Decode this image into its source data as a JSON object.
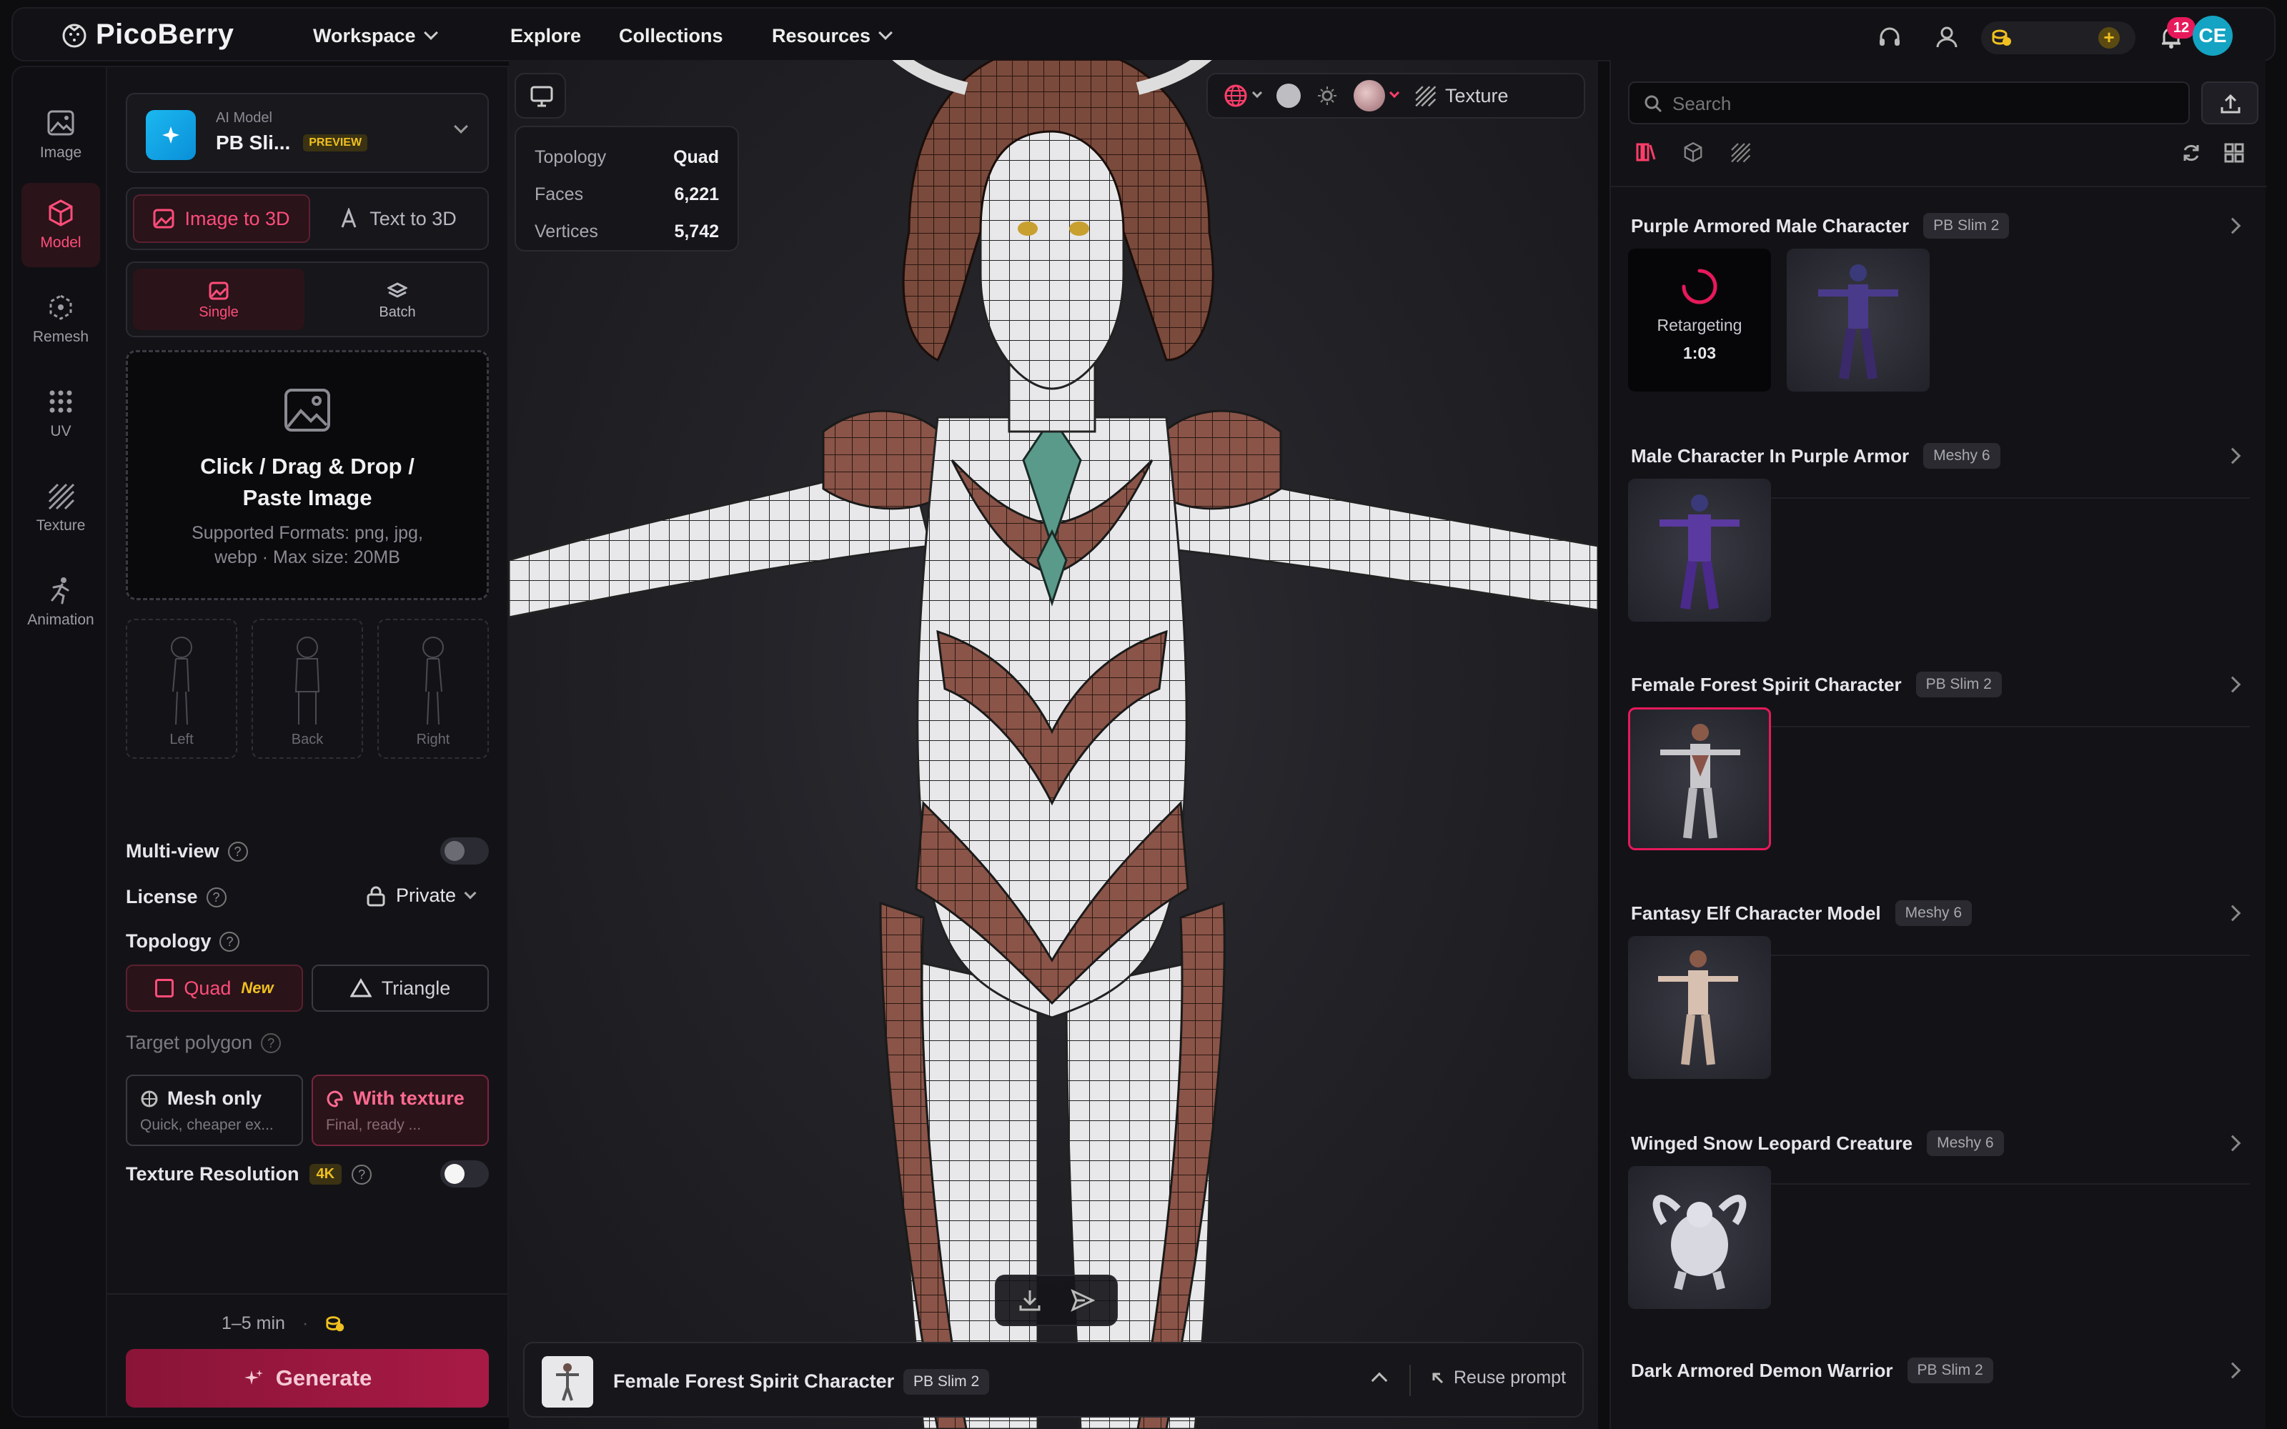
{
  "brand": {
    "name": "PicoBerry"
  },
  "nav": [
    {
      "label": "Workspace",
      "dropdown": true
    },
    {
      "label": "Explore",
      "dropdown": false
    },
    {
      "label": "Collections",
      "dropdown": false
    },
    {
      "label": "Resources",
      "dropdown": true
    }
  ],
  "topbar": {
    "notification_count": "12",
    "user_initials": "CE"
  },
  "rail": [
    {
      "label": "Image",
      "icon": "image-icon",
      "active": false
    },
    {
      "label": "Model",
      "icon": "cube-icon",
      "active": true
    },
    {
      "label": "Remesh",
      "icon": "remesh-icon",
      "active": false
    },
    {
      "label": "UV",
      "icon": "uv-grid-icon",
      "active": false
    },
    {
      "label": "Texture",
      "icon": "texture-icon",
      "active": false
    },
    {
      "label": "Animation",
      "icon": "running-figure-icon",
      "active": false
    }
  ],
  "panel": {
    "model": {
      "caption": "AI Model",
      "name": "PB Sli...",
      "badge": "PREVIEW"
    },
    "modes": [
      "Image to 3D",
      "Text to 3D"
    ],
    "submodes": [
      "Single",
      "Batch"
    ],
    "upload": {
      "title": "Click / Drag & Drop / Paste Image",
      "hint": "Supported Formats: png, jpg, webp · Max size: 20MB"
    },
    "views": [
      "Left",
      "Back",
      "Right"
    ],
    "multiview_label": "Multi-view",
    "license_label": "License",
    "license_value": "Private",
    "topology_label": "Topology",
    "topology_options": [
      {
        "label": "Quad",
        "tag": "New"
      },
      {
        "label": "Triangle",
        "tag": ""
      }
    ],
    "target_polygon_label": "Target polygon",
    "mesh_options": [
      {
        "title": "Mesh only",
        "sub": "Quick, cheaper ex..."
      },
      {
        "title": "With texture",
        "sub": "Final, ready ..."
      }
    ],
    "texres_label": "Texture Resolution",
    "texres_badge": "4K",
    "eta": "1–5 min",
    "generate_label": "Generate"
  },
  "stats": [
    {
      "label": "Topology",
      "value": "Quad"
    },
    {
      "label": "Faces",
      "value": "6,221"
    },
    {
      "label": "Vertices",
      "value": "5,742"
    }
  ],
  "viewport_toolbar": {
    "texture_label": "Texture"
  },
  "bottom_bar": {
    "title": "Female Forest Spirit Character",
    "tag": "PB Slim 2",
    "reuse": "Reuse prompt"
  },
  "search": {
    "placeholder": "Search"
  },
  "assets": [
    {
      "title": "Purple Armored Male Character",
      "tag": "PB Slim 2",
      "status": "Retargeting",
      "time": "1:03"
    },
    {
      "title": "Male Character In Purple Armor",
      "tag": "Meshy 6"
    },
    {
      "title": "Female Forest Spirit Character",
      "tag": "PB Slim 2"
    },
    {
      "title": "Fantasy Elf Character Model",
      "tag": "Meshy 6"
    },
    {
      "title": "Winged Snow Leopard Creature",
      "tag": "Meshy 6"
    },
    {
      "title": "Dark Armored Demon Warrior",
      "tag": "PB Slim 2"
    }
  ],
  "colors": {
    "accent": "#e6195b",
    "accent_dark": "#2a1319",
    "gold": "#f0c020",
    "teal": "#14a3c2"
  }
}
